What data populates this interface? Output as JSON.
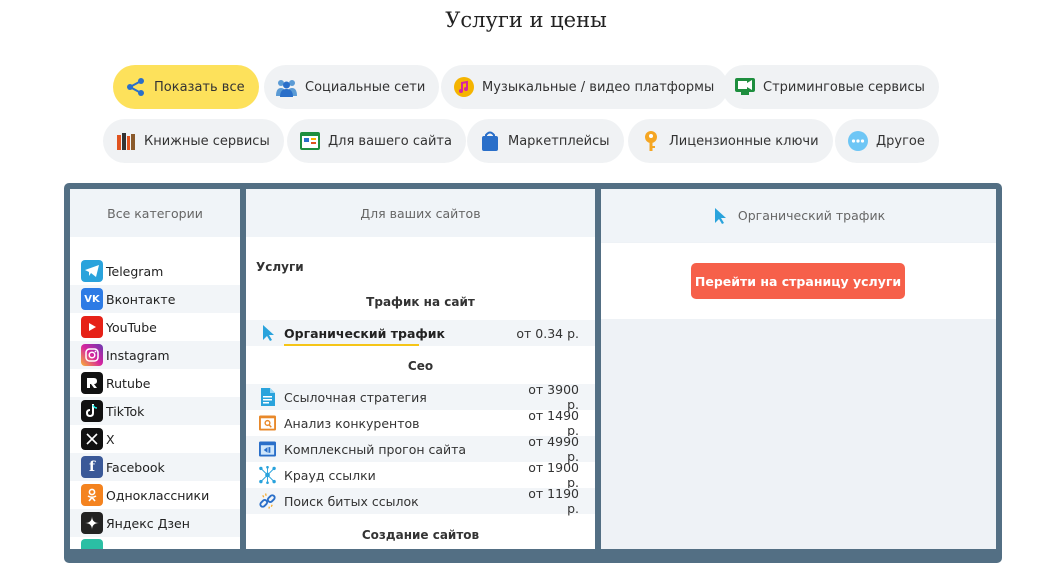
{
  "page": {
    "title": "Услуги и цены"
  },
  "filters": [
    {
      "label": "Показать все",
      "icon": "share-icon",
      "active": true
    },
    {
      "label": "Социальные сети",
      "icon": "people-icon"
    },
    {
      "label": "Музыкальные / видео платформы",
      "icon": "music-icon"
    },
    {
      "label": "Стриминговые сервисы",
      "icon": "stream-icon"
    },
    {
      "label": "Книжные сервисы",
      "icon": "books-icon"
    },
    {
      "label": "Для вашего сайта",
      "icon": "website-icon"
    },
    {
      "label": "Маркетплейсы",
      "icon": "bag-icon"
    },
    {
      "label": "Лицензионные ключи",
      "icon": "key-icon"
    },
    {
      "label": "Другое",
      "icon": "dots-icon"
    }
  ],
  "categories": {
    "header": "Все категории",
    "items": [
      {
        "label": "Telegram",
        "icon": "telegram-icon",
        "color": "#2aa3dc"
      },
      {
        "label": "Вконтакте",
        "icon": "vk-icon",
        "color": "#2d7be5"
      },
      {
        "label": "YouTube",
        "icon": "youtube-icon",
        "color": "#e62117"
      },
      {
        "label": "Instagram",
        "icon": "instagram-icon",
        "color": "#d6249f"
      },
      {
        "label": "Rutube",
        "icon": "rutube-icon",
        "color": "#111111"
      },
      {
        "label": "TikTok",
        "icon": "tiktok-icon",
        "color": "#111111"
      },
      {
        "label": "X",
        "icon": "x-icon",
        "color": "#111111"
      },
      {
        "label": "Facebook",
        "icon": "facebook-icon",
        "color": "#3b5998"
      },
      {
        "label": "Одноклассники",
        "icon": "odnoklassniki-icon",
        "color": "#f4831f"
      },
      {
        "label": "Яндекс Дзен",
        "icon": "dzen-icon",
        "color": "#222222"
      }
    ]
  },
  "services": {
    "header": "Для ваших сайтов",
    "section_title": "Услуги",
    "groups": [
      {
        "title": "Трафик на сайт"
      },
      {
        "title": "Сео"
      },
      {
        "title": "Создание сайтов"
      }
    ],
    "items": [
      {
        "name": "Органический трафик",
        "price": "от 0.34 р.",
        "icon": "cursor-icon",
        "selected": true
      },
      {
        "name": "Ссылочная стратегия",
        "price": "от 3900 р.",
        "icon": "document-icon"
      },
      {
        "name": "Анализ конкурентов",
        "price": "от 1490 р.",
        "icon": "analysis-icon"
      },
      {
        "name": "Комплексный прогон сайта",
        "price": "от 4990 р.",
        "icon": "browser-icon"
      },
      {
        "name": "Крауд ссылки",
        "price": "от 1900 р.",
        "icon": "network-icon"
      },
      {
        "name": "Поиск битых ссылок",
        "price": "от 1190 р.",
        "icon": "broken-link-icon"
      }
    ]
  },
  "detail": {
    "header": "Органический трафик",
    "button": "Перейти на страницу услуги"
  },
  "colors": {
    "active_filter": "#fde15b",
    "frame": "#536f84",
    "button": "#f6604a",
    "accent_underline": "#f5c518"
  }
}
